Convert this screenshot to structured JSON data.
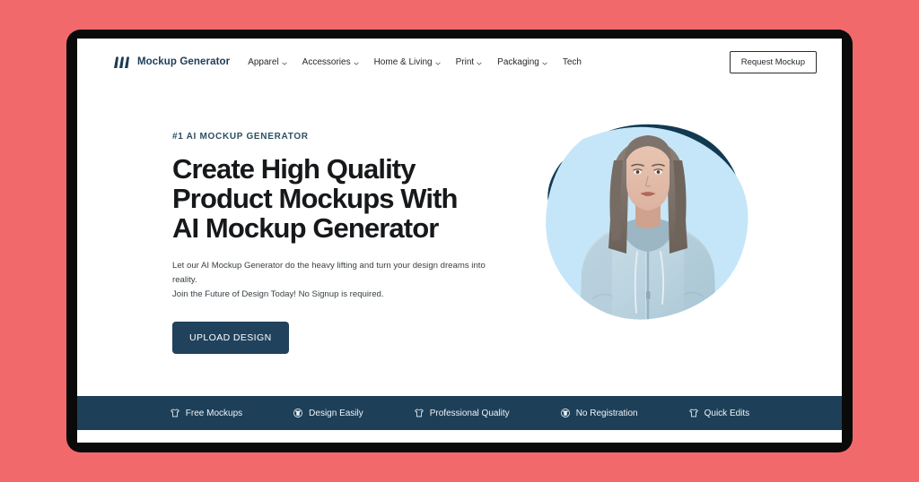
{
  "theme": {
    "page_background": "#f2696c",
    "frame": "#0a0a0a",
    "screen": "#ffffff",
    "navy": "#1e3f58",
    "cta": "#20425c",
    "blob_dark": "#113a52",
    "blob_light": "#c5e6f8",
    "hoodie": "#bcd5e0"
  },
  "navbar": {
    "logo_icon": "bars-logo-icon",
    "brand": "Mockup Generator",
    "links": [
      {
        "label": "Apparel",
        "has_caret": true,
        "icon": "chevron-down-icon"
      },
      {
        "label": "Accessories",
        "has_caret": true,
        "icon": "chevron-down-icon"
      },
      {
        "label": "Home & Living",
        "has_caret": true,
        "icon": "chevron-down-icon"
      },
      {
        "label": "Print",
        "has_caret": true,
        "icon": "chevron-down-icon"
      },
      {
        "label": "Packaging",
        "has_caret": true,
        "icon": "chevron-down-icon"
      },
      {
        "label": "Tech",
        "has_caret": false,
        "icon": ""
      }
    ],
    "request_button": "Request Mockup"
  },
  "hero": {
    "eyebrow": "#1 AI MOCKUP GENERATOR",
    "headline_line1": "Create High Quality",
    "headline_line2": "Product Mockups With",
    "headline_line3": "AI Mockup Generator",
    "subcopy_line1": "Let our AI Mockup Generator do the heavy lifting and turn your design dreams into reality.",
    "subcopy_line2": "Join the Future of Design Today! No Signup is required.",
    "cta_label": "UPLOAD DESIGN",
    "image_alt": "model-in-hoodie-photo"
  },
  "feature_bar": {
    "items": [
      {
        "label": "Free Mockups",
        "icon": "tshirt-icon"
      },
      {
        "label": "Design Easily",
        "icon": "tshirt-badge-icon"
      },
      {
        "label": "Professional Quality",
        "icon": "tshirt-icon"
      },
      {
        "label": "No Registration",
        "icon": "tshirt-badge-icon"
      },
      {
        "label": "Quick Edits",
        "icon": "tshirt-icon"
      }
    ]
  }
}
